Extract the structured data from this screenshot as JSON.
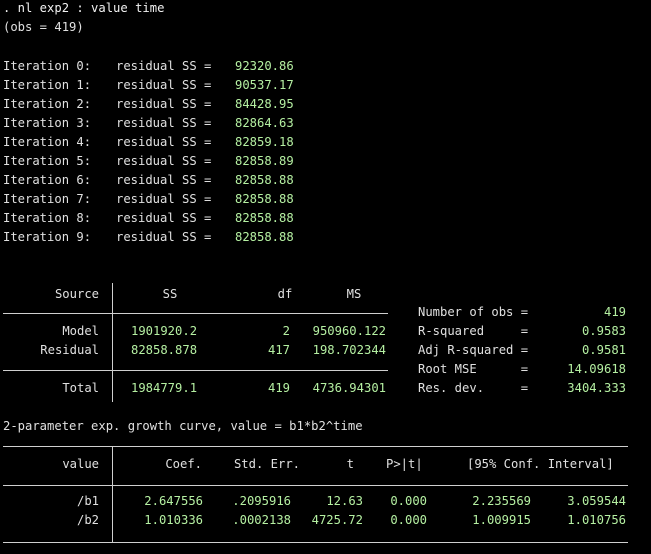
{
  "command": ". nl exp2 : value time",
  "obs_line": "(obs = 419)",
  "iteration_label": "residual SS =",
  "iterations": [
    {
      "label": "Iteration 0:",
      "value": "92320.86"
    },
    {
      "label": "Iteration 1:",
      "value": "90537.17"
    },
    {
      "label": "Iteration 2:",
      "value": "84428.95"
    },
    {
      "label": "Iteration 3:",
      "value": "82864.63"
    },
    {
      "label": "Iteration 4:",
      "value": "82859.18"
    },
    {
      "label": "Iteration 5:",
      "value": "82858.89"
    },
    {
      "label": "Iteration 6:",
      "value": "82858.88"
    },
    {
      "label": "Iteration 7:",
      "value": "82858.88"
    },
    {
      "label": "Iteration 8:",
      "value": "82858.88"
    },
    {
      "label": "Iteration 9:",
      "value": "82858.88"
    }
  ],
  "anova": {
    "headers": {
      "source": "Source",
      "ss": "SS",
      "df": "df",
      "ms": "MS"
    },
    "rows": [
      {
        "source": "Model",
        "ss": "1901920.2",
        "df": "2",
        "ms": "950960.122"
      },
      {
        "source": "Residual",
        "ss": "82858.878",
        "df": "417",
        "ms": "198.702344"
      },
      {
        "source": "Total",
        "ss": "1984779.1",
        "df": "419",
        "ms": "4736.94301"
      }
    ]
  },
  "stats": [
    {
      "label": "Number of obs =",
      "value": "419"
    },
    {
      "label": "R-squared     =",
      "value": "0.9583"
    },
    {
      "label": "Adj R-squared =",
      "value": "0.9581"
    },
    {
      "label": "Root MSE      =",
      "value": "14.09618"
    },
    {
      "label": "Res. dev.     =",
      "value": "3404.333"
    }
  ],
  "model_desc": "2-parameter exp. growth curve, value = b1*b2^time",
  "coef": {
    "headers": {
      "var": "value",
      "coef": "Coef.",
      "se": "Std. Err.",
      "t": "t",
      "p": "P>|t|",
      "ci": "[95% Conf. Interval]"
    },
    "rows": [
      {
        "var": "/b1",
        "coef": "2.647556",
        "se": ".2095916",
        "t": "12.63",
        "p": "0.000",
        "lo": "2.235569",
        "hi": "3.059544"
      },
      {
        "var": "/b2",
        "coef": "1.010336",
        "se": ".0002138",
        "t": "4725.72",
        "p": "0.000",
        "lo": "1.009915",
        "hi": "1.010756"
      }
    ]
  },
  "colors": {
    "background": "#000000",
    "text": "#e0e0e0",
    "result": "#b5f0a2",
    "rule": "#cfcfcf"
  }
}
